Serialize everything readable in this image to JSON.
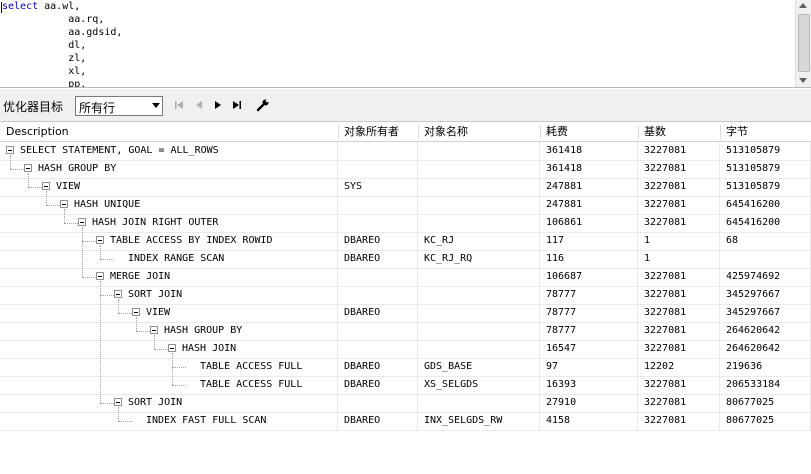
{
  "editor": {
    "keyword": "select",
    "lines": [
      " aa.wl,",
      "           aa.rq,",
      "           aa.gdsid,",
      "           dl,",
      "           zl,",
      "           xl,",
      "           pp,"
    ]
  },
  "toolbar": {
    "optimizer_label": "优化器目标",
    "optimizer_value": "所有行",
    "buttons": [
      "first-icon",
      "prev-icon",
      "next-icon",
      "last-icon",
      "wrench-icon"
    ]
  },
  "grid": {
    "columns": {
      "description": "Description",
      "owner": "对象所有者",
      "object": "对象名称",
      "cost": "耗费",
      "cardinality": "基数",
      "bytes": "字节"
    },
    "rows": [
      {
        "desc": "SELECT STATEMENT, GOAL = ALL_ROWS",
        "owner": "",
        "object": "",
        "cost": "361418",
        "card": "3227081",
        "bytes": "513105879",
        "depth": 0,
        "expandable": true
      },
      {
        "desc": "HASH GROUP BY",
        "owner": "",
        "object": "",
        "cost": "361418",
        "card": "3227081",
        "bytes": "513105879",
        "depth": 1,
        "expandable": true
      },
      {
        "desc": "VIEW",
        "owner": "SYS",
        "object": "",
        "cost": "247881",
        "card": "3227081",
        "bytes": "513105879",
        "depth": 2,
        "expandable": true
      },
      {
        "desc": "HASH UNIQUE",
        "owner": "",
        "object": "",
        "cost": "247881",
        "card": "3227081",
        "bytes": "645416200",
        "depth": 3,
        "expandable": true
      },
      {
        "desc": "HASH JOIN RIGHT OUTER",
        "owner": "",
        "object": "",
        "cost": "106861",
        "card": "3227081",
        "bytes": "645416200",
        "depth": 4,
        "expandable": true
      },
      {
        "desc": "TABLE ACCESS BY INDEX ROWID",
        "owner": "DBAREO",
        "object": "KC_RJ",
        "cost": "117",
        "card": "1",
        "bytes": "68",
        "depth": 5,
        "expandable": true
      },
      {
        "desc": "INDEX RANGE SCAN",
        "owner": "DBAREO",
        "object": "KC_RJ_RQ",
        "cost": "116",
        "card": "1",
        "bytes": "",
        "depth": 6,
        "expandable": false
      },
      {
        "desc": "MERGE JOIN",
        "owner": "",
        "object": "",
        "cost": "106687",
        "card": "3227081",
        "bytes": "425974692",
        "depth": 5,
        "expandable": true
      },
      {
        "desc": "SORT JOIN",
        "owner": "",
        "object": "",
        "cost": "78777",
        "card": "3227081",
        "bytes": "345297667",
        "depth": 6,
        "expandable": true
      },
      {
        "desc": "VIEW",
        "owner": "DBAREO",
        "object": "",
        "cost": "78777",
        "card": "3227081",
        "bytes": "345297667",
        "depth": 7,
        "expandable": true
      },
      {
        "desc": "HASH GROUP BY",
        "owner": "",
        "object": "",
        "cost": "78777",
        "card": "3227081",
        "bytes": "264620642",
        "depth": 8,
        "expandable": true
      },
      {
        "desc": "HASH JOIN",
        "owner": "",
        "object": "",
        "cost": "16547",
        "card": "3227081",
        "bytes": "264620642",
        "depth": 9,
        "expandable": true
      },
      {
        "desc": "TABLE ACCESS FULL",
        "owner": "DBAREO",
        "object": "GDS_BASE",
        "cost": "97",
        "card": "12202",
        "bytes": "219636",
        "depth": 10,
        "expandable": false
      },
      {
        "desc": "TABLE ACCESS FULL",
        "owner": "DBAREO",
        "object": "XS_SELGDS",
        "cost": "16393",
        "card": "3227081",
        "bytes": "206533184",
        "depth": 10,
        "expandable": false
      },
      {
        "desc": "SORT JOIN",
        "owner": "",
        "object": "",
        "cost": "27910",
        "card": "3227081",
        "bytes": "80677025",
        "depth": 6,
        "expandable": true
      },
      {
        "desc": "INDEX FAST FULL SCAN",
        "owner": "DBAREO",
        "object": "INX_SELGDS_RW",
        "cost": "4158",
        "card": "3227081",
        "bytes": "80677025",
        "depth": 7,
        "expandable": false
      }
    ]
  }
}
